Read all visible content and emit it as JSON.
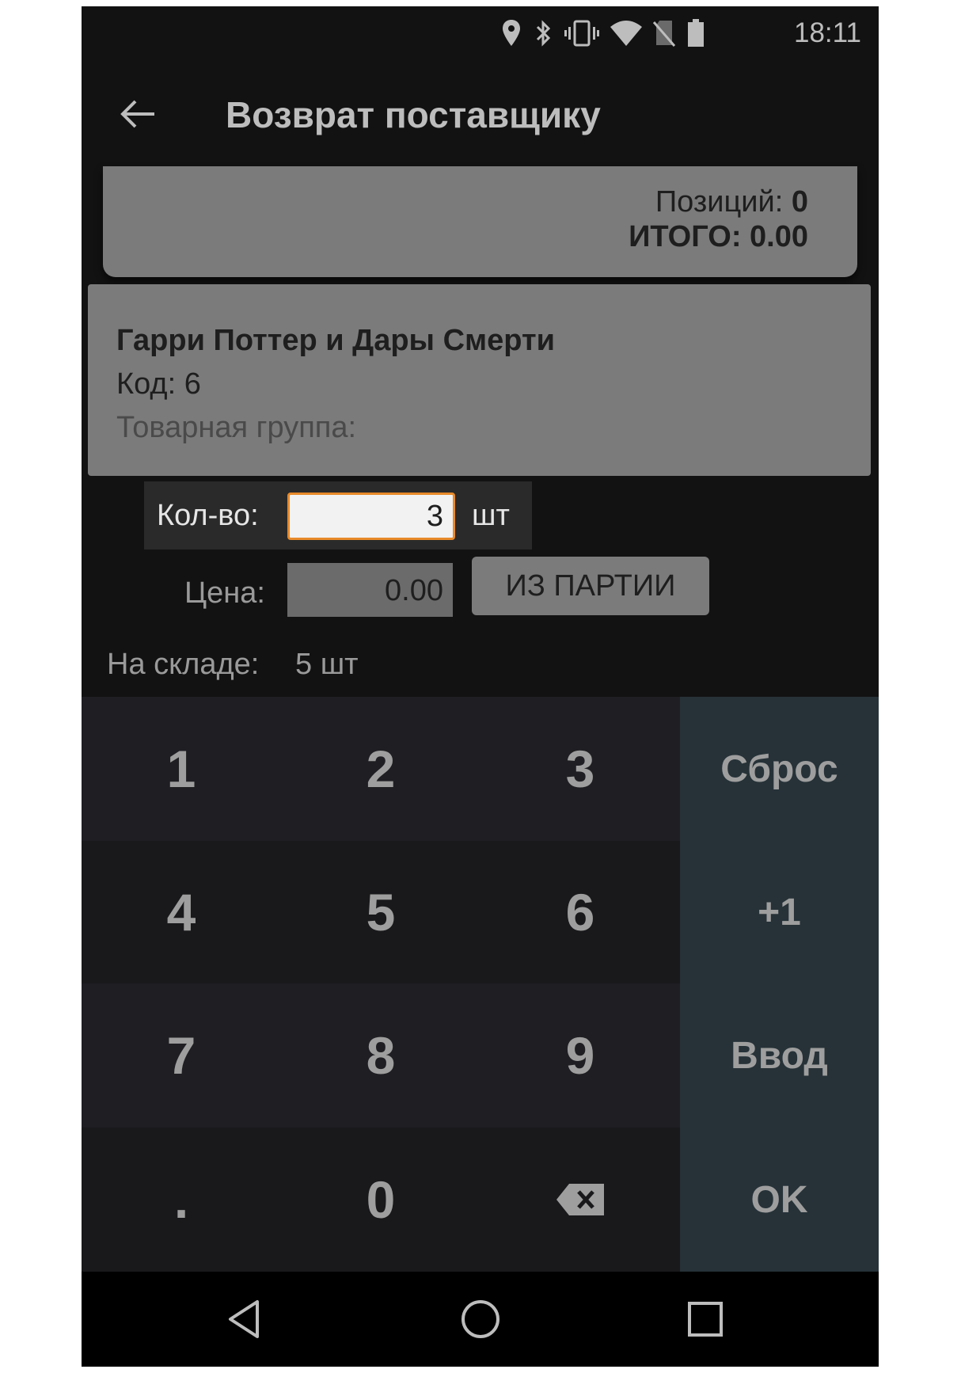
{
  "status_bar": {
    "time": "18:11",
    "icons": [
      "location-icon",
      "bluetooth-icon",
      "vibrate-icon",
      "wifi-icon",
      "no-sim-icon",
      "battery-icon"
    ]
  },
  "app_bar": {
    "title": "Возврат поставщику",
    "back_icon": "back-arrow-icon"
  },
  "summary": {
    "positions_label": "Позиций:",
    "positions_value": "0",
    "total_label": "ИТОГО:",
    "total_value": "0.00"
  },
  "product": {
    "name": "Гарри Поттер и Дары Смерти",
    "code": "Код: 6",
    "group": "Товарная группа:"
  },
  "quantity": {
    "label": "Кол-во:",
    "value": "3",
    "unit": "шт"
  },
  "price": {
    "label": "Цена:",
    "value": "0.00",
    "batch_button": "ИЗ ПАРТИИ"
  },
  "stock": {
    "label": "На складе:",
    "value": "5 шт"
  },
  "keypad": {
    "digits": [
      "1",
      "2",
      "3",
      "4",
      "5",
      "6",
      "7",
      "8",
      "9",
      ".",
      "0"
    ],
    "backspace_icon": "backspace-icon",
    "functions": [
      "Сброс",
      "+1",
      "Ввод",
      "OK"
    ]
  },
  "nav_bar": {
    "icons": [
      "nav-back-icon",
      "nav-home-icon",
      "nav-recents-icon"
    ]
  },
  "colors": {
    "accent_border": "#e88a2a",
    "function_key_bg": "#263238",
    "card_bg": "#7b7b7b"
  }
}
